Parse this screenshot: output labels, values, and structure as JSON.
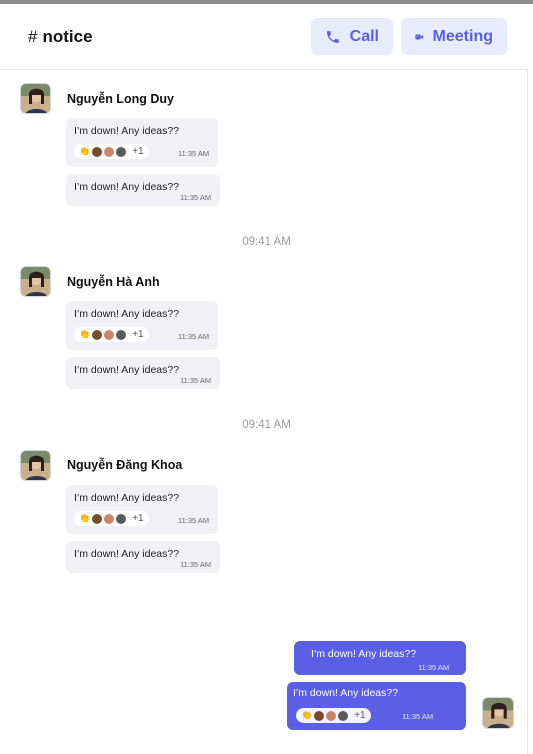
{
  "header": {
    "hash": "#",
    "channel": "notice",
    "call_label": "Call",
    "meeting_label": "Meeting"
  },
  "groups": [
    {
      "sender": "Nguyễn Long Duy",
      "msg1": "I’m down! Any ideas??",
      "msg1_time": "11:35 AM",
      "reaction_more": "+1",
      "msg2": "I’m down! Any ideas??",
      "msg2_time": "11:35 AM"
    },
    {
      "sender": "Nguyễn Hà Anh",
      "msg1": "I’m down! Any ideas??",
      "msg1_time": "11:35 AM",
      "reaction_more": "+1",
      "msg2": "I’m down! Any ideas??",
      "msg2_time": "11:35 AM"
    },
    {
      "sender": "Nguyễn Đăng Khoa",
      "msg1": "I’m down! Any ideas??",
      "msg1_time": "11:35 AM",
      "reaction_more": "+1",
      "msg2": "I’m down! Any ideas??",
      "msg2_time": "11:35 AM"
    }
  ],
  "separators": [
    "09:41 AM",
    "09:41 AM"
  ],
  "own": {
    "msg1": "I’m down! Any ideas??",
    "msg1_time": "11:35 AM",
    "msg2": "I’m down! Any ideas??",
    "msg2_time": "11:35 AM",
    "reaction_more": "+1"
  },
  "colors": {
    "accent": "#5b5fe6",
    "button_bg": "#e8ebfb",
    "bubble_bg": "#f1f1f5"
  }
}
